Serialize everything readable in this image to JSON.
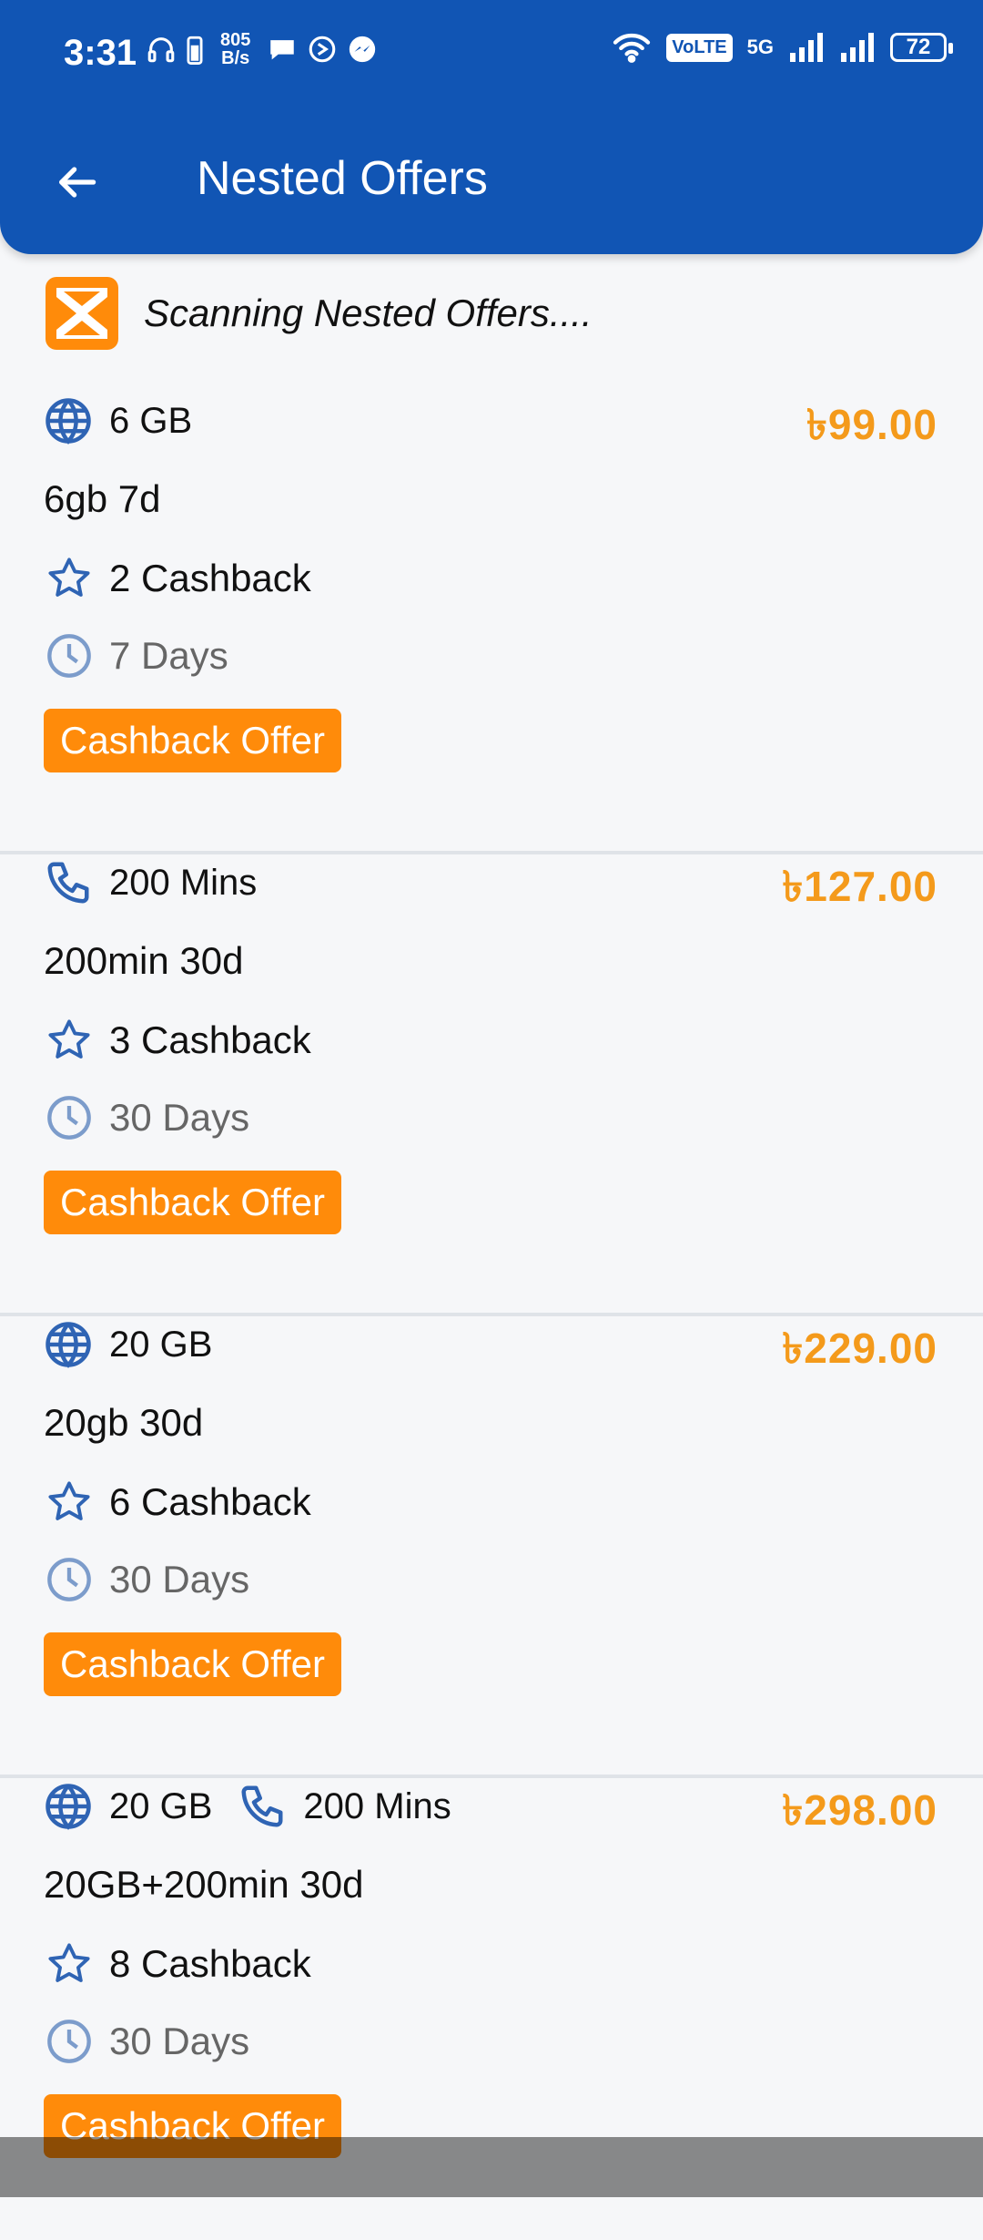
{
  "status": {
    "time": "3:31",
    "speed_top": "805",
    "speed_bottom": "B/s",
    "volte": "VoLTE",
    "net": "5G",
    "battery": "72"
  },
  "header": {
    "title": "Nested Offers"
  },
  "scan": {
    "text": "Scanning Nested Offers...."
  },
  "offers": [
    {
      "features": [
        {
          "icon": "globe-icon",
          "text": "6 GB"
        }
      ],
      "price": "৳99.00",
      "name": "6gb 7d",
      "cashback": "2 Cashback",
      "validity": "7 Days",
      "cta": "Cashback Offer"
    },
    {
      "features": [
        {
          "icon": "phone-icon",
          "text": "200 Mins"
        }
      ],
      "price": "৳127.00",
      "name": "200min 30d",
      "cashback": "3 Cashback",
      "validity": "30 Days",
      "cta": "Cashback Offer"
    },
    {
      "features": [
        {
          "icon": "globe-icon",
          "text": "20 GB"
        }
      ],
      "price": "৳229.00",
      "name": "20gb 30d",
      "cashback": "6 Cashback",
      "validity": "30 Days",
      "cta": "Cashback Offer"
    },
    {
      "features": [
        {
          "icon": "globe-icon",
          "text": "20 GB"
        },
        {
          "icon": "phone-icon",
          "text": "200 Mins"
        }
      ],
      "price": "৳298.00",
      "name": "20GB+200min 30d",
      "cashback": "8 Cashback",
      "validity": "30 Days",
      "cta": "Cashback Offer"
    }
  ],
  "colors": {
    "primary": "#1155B4",
    "accent": "#FF8B0A",
    "price": "#F49A1B",
    "icon": "#2F64B4"
  }
}
